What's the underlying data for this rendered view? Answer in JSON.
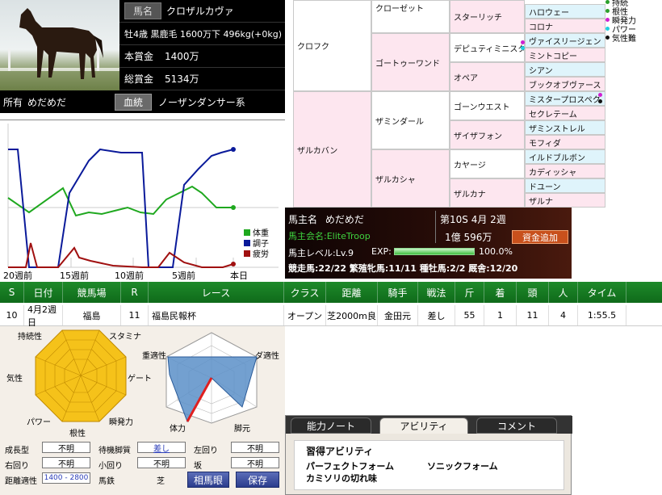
{
  "horse": {
    "name_label": "馬名",
    "name": "クロザルカヴァ",
    "profile": "牡4歳 黒鹿毛 1600万下 496kg(+0kg)",
    "prize_label": "本賞金",
    "prize": "1400万",
    "total_prize_label": "総賞金",
    "total_prize": "5134万",
    "owner_label": "所有",
    "owner": "めだめだ",
    "bloodline_button": "血統",
    "bloodline": "ノーザンダンサー系"
  },
  "pedigree": {
    "sire": "クロフク",
    "dam": "ザルカバン",
    "g2": [
      "クローゼット",
      "ゴートゥーワンド",
      "ザミンダール",
      "ザルカシャ"
    ],
    "g3": [
      "スターリッチ",
      "デピュティミニスタ",
      "オペア",
      "ゴーンウエスト",
      "ザイザフォン",
      "カヤージ",
      "ザルカナ"
    ],
    "g4": [
      "ハロウェー",
      "コロナ",
      "ヴァイスリージェン",
      "ミントコピー",
      "シアン",
      "ブックオブヴァース",
      "ミスタープロスペク",
      "セクレテーム",
      "ザミンストレル",
      "モフィダ",
      "イルドブルボン",
      "カディッシャ",
      "ドユーン",
      "ザルナ"
    ]
  },
  "legend": {
    "items": [
      {
        "label": "持続",
        "color": "#2ba02b"
      },
      {
        "label": "根性",
        "color": "#2ba02b"
      },
      {
        "label": "瞬発力",
        "color": "#d020d0"
      },
      {
        "label": "パワー",
        "color": "#20d0e0"
      },
      {
        "label": "気性難",
        "color": "#111111"
      }
    ]
  },
  "condition_chart": {
    "x_ticks": [
      "20週前",
      "15週前",
      "10週前",
      "5週前",
      "本日"
    ],
    "legend": [
      {
        "label": "体重",
        "color": "#1fa81f"
      },
      {
        "label": "調子",
        "color": "#0a1a9a"
      },
      {
        "label": "疲労",
        "color": "#a01010"
      }
    ]
  },
  "owner_panel": {
    "owner_label": "馬主名",
    "owner_name": "めだめだ",
    "club_label": "馬主会名:",
    "club_name": "EliteTroop",
    "period": "第10S 4月 2週",
    "funds": "1億 596万",
    "funds_button": "資金追加",
    "level_label": "馬主レベル:",
    "level": "Lv.9",
    "exp_label": "EXP:",
    "exp_percent_text": "100.0%",
    "exp_fraction": 1.0,
    "stats": "競走馬:22/22 繁殖牝馬:11/11 種牡馬:2/2 厩舎:12/20"
  },
  "race_table": {
    "headers": [
      "S",
      "日付",
      "競馬場",
      "R",
      "レース",
      "クラス",
      "距離",
      "騎手",
      "戦法",
      "斤",
      "着",
      "頭",
      "人",
      "タイム"
    ],
    "row": [
      "10",
      "4月2週 日",
      "福島",
      "11",
      "福島民報杯",
      "オープン",
      "芝2000m良",
      "金田元",
      "差し",
      "55",
      "1",
      "11",
      "4",
      "1:55.5"
    ]
  },
  "ability": {
    "octagon_labels": [
      "スタミナ",
      "ゲート",
      "瞬発力",
      "根性",
      "パワー",
      "気性",
      "持続性"
    ],
    "hexagon_labels": [
      "ダ適性",
      "脚元",
      "体力",
      "重適性"
    ],
    "fields": {
      "growth_label": "成長型",
      "growth": "不明",
      "pace_label": "待機脚質",
      "pace": "差し",
      "left_label": "左回り",
      "left": "不明",
      "right_label": "右回り",
      "right": "不明",
      "small_label": "小回り",
      "small": "不明",
      "slope_label": "坂",
      "slope": "不明",
      "distance_label": "距離適性",
      "distance": "1400 - 2800",
      "surface_label": "馬鉄",
      "surface": "芝"
    },
    "buttons": {
      "compat": "相馬眼",
      "save": "保存"
    }
  },
  "tab_panel": {
    "tabs": [
      "能力ノート",
      "アビリティ",
      "コメント"
    ],
    "active_tab": "アビリティ",
    "heading": "習得アビリティ",
    "abilities": [
      "パーフェクトフォーム",
      "ソニックフォーム",
      "カミソリの切れ味"
    ]
  }
}
